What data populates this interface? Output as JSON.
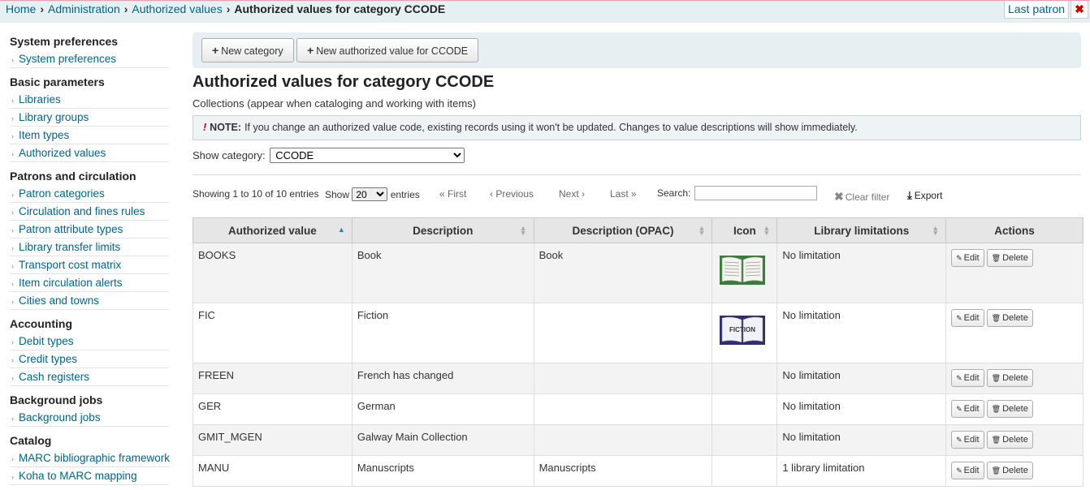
{
  "breadcrumb": {
    "items": [
      "Home",
      "Administration",
      "Authorized values"
    ],
    "current": "Authorized values for category CCODE"
  },
  "header": {
    "last_patron": "Last patron",
    "close": "✖"
  },
  "sidebar": [
    {
      "title": "System preferences",
      "items": [
        "System preferences"
      ]
    },
    {
      "title": "Basic parameters",
      "items": [
        "Libraries",
        "Library groups",
        "Item types",
        "Authorized values"
      ]
    },
    {
      "title": "Patrons and circulation",
      "items": [
        "Patron categories",
        "Circulation and fines rules",
        "Patron attribute types",
        "Library transfer limits",
        "Transport cost matrix",
        "Item circulation alerts",
        "Cities and towns"
      ]
    },
    {
      "title": "Accounting",
      "items": [
        "Debit types",
        "Credit types",
        "Cash registers"
      ]
    },
    {
      "title": "Background jobs",
      "items": [
        "Background jobs"
      ]
    },
    {
      "title": "Catalog",
      "items": [
        "MARC bibliographic framework",
        "Koha to MARC mapping"
      ]
    }
  ],
  "toolbar": {
    "new_category": "New category",
    "new_value": "New authorized value for CCODE"
  },
  "page": {
    "title": "Authorized values for category CCODE",
    "subtitle": "Collections (appear when cataloging and working with items)",
    "note_label": "NOTE:",
    "note_text": "If you change an authorized value code, existing records using it won't be updated. Changes to value descriptions will show immediately.",
    "show_category_label": "Show category:",
    "show_category_value": "CCODE"
  },
  "table_controls": {
    "info": "Showing 1 to 10 of 10 entries",
    "show_label": "Show",
    "show_value": "20",
    "entries_label": "entries",
    "first": "« First",
    "previous": "‹ Previous",
    "next": "Next ›",
    "last": "Last »",
    "search_label": "Search:",
    "search_value": "",
    "clear_filter": "Clear filter",
    "export": "Export"
  },
  "table": {
    "columns": [
      "Authorized value",
      "Description",
      "Description (OPAC)",
      "Icon",
      "Library limitations",
      "Actions"
    ],
    "edit_label": "Edit",
    "delete_label": "Delete",
    "rows": [
      {
        "value": "BOOKS",
        "description": "Book",
        "opac": "Book",
        "icon": "green-book-icon",
        "limits": "No limitation"
      },
      {
        "value": "FIC",
        "description": "Fiction",
        "opac": "",
        "icon": "fiction-book-icon",
        "icon_text": "FICTION",
        "limits": "No limitation"
      },
      {
        "value": "FREEN",
        "description": "French has changed",
        "opac": "",
        "icon": "",
        "limits": "No limitation"
      },
      {
        "value": "GER",
        "description": "German",
        "opac": "",
        "icon": "",
        "limits": "No limitation"
      },
      {
        "value": "GMIT_MGEN",
        "description": "Galway Main Collection",
        "opac": "",
        "icon": "",
        "limits": "No limitation"
      },
      {
        "value": "MANU",
        "description": "Manuscripts",
        "opac": "Manuscripts",
        "icon": "",
        "limits": "1 library limitation"
      }
    ]
  }
}
